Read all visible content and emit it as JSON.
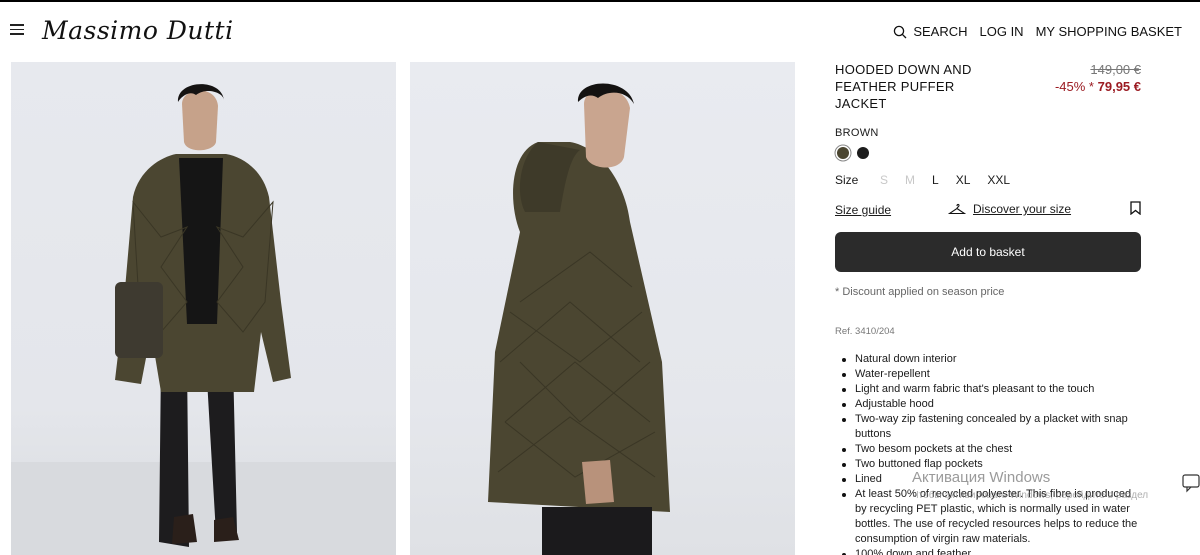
{
  "header": {
    "brand": "Massimo Dutti",
    "search_label": "SEARCH",
    "login_label": "LOG IN",
    "basket_label": "MY SHOPPING BASKET"
  },
  "product": {
    "title": "HOODED DOWN AND FEATHER PUFFER JACKET",
    "original_price": "149,00 €",
    "discount": "-45% *",
    "sale_price": "79,95 €",
    "color_label": "BROWN",
    "swatches": [
      "#4a4530",
      "#1c1c1c"
    ],
    "size_label": "Size",
    "sizes": [
      {
        "label": "S",
        "available": false
      },
      {
        "label": "M",
        "available": false
      },
      {
        "label": "L",
        "available": true
      },
      {
        "label": "XL",
        "available": true
      },
      {
        "label": "XXL",
        "available": true
      }
    ],
    "size_guide": "Size guide",
    "discover_size": "Discover your size",
    "add_to_basket": "Add to basket",
    "discount_note": "* Discount applied on season price",
    "reference": "Ref. 3410/204",
    "features": [
      "Natural down interior",
      "Water-repellent",
      "Light and warm fabric that's pleasant to the touch",
      "Adjustable hood",
      "Two-way zip fastening concealed by a placket with snap buttons",
      "Two besom pockets at the chest",
      "Two buttoned flap pockets",
      "Lined",
      "At least 50% of recycled polyester. This fibre is produced by recycling PET plastic, which is normally used in water bottles. The use of recycled resources helps to reduce the consumption of virgin raw materials.",
      "100% down and feather..."
    ]
  },
  "system": {
    "activation_title": "Активация Windows",
    "activation_sub": "Чтобы активировать Windows, перейдите в раздел"
  },
  "colors": {
    "accent_sale": "#9b1b22",
    "button_bg": "#2b2b2b",
    "jacket": "#4a4530"
  }
}
